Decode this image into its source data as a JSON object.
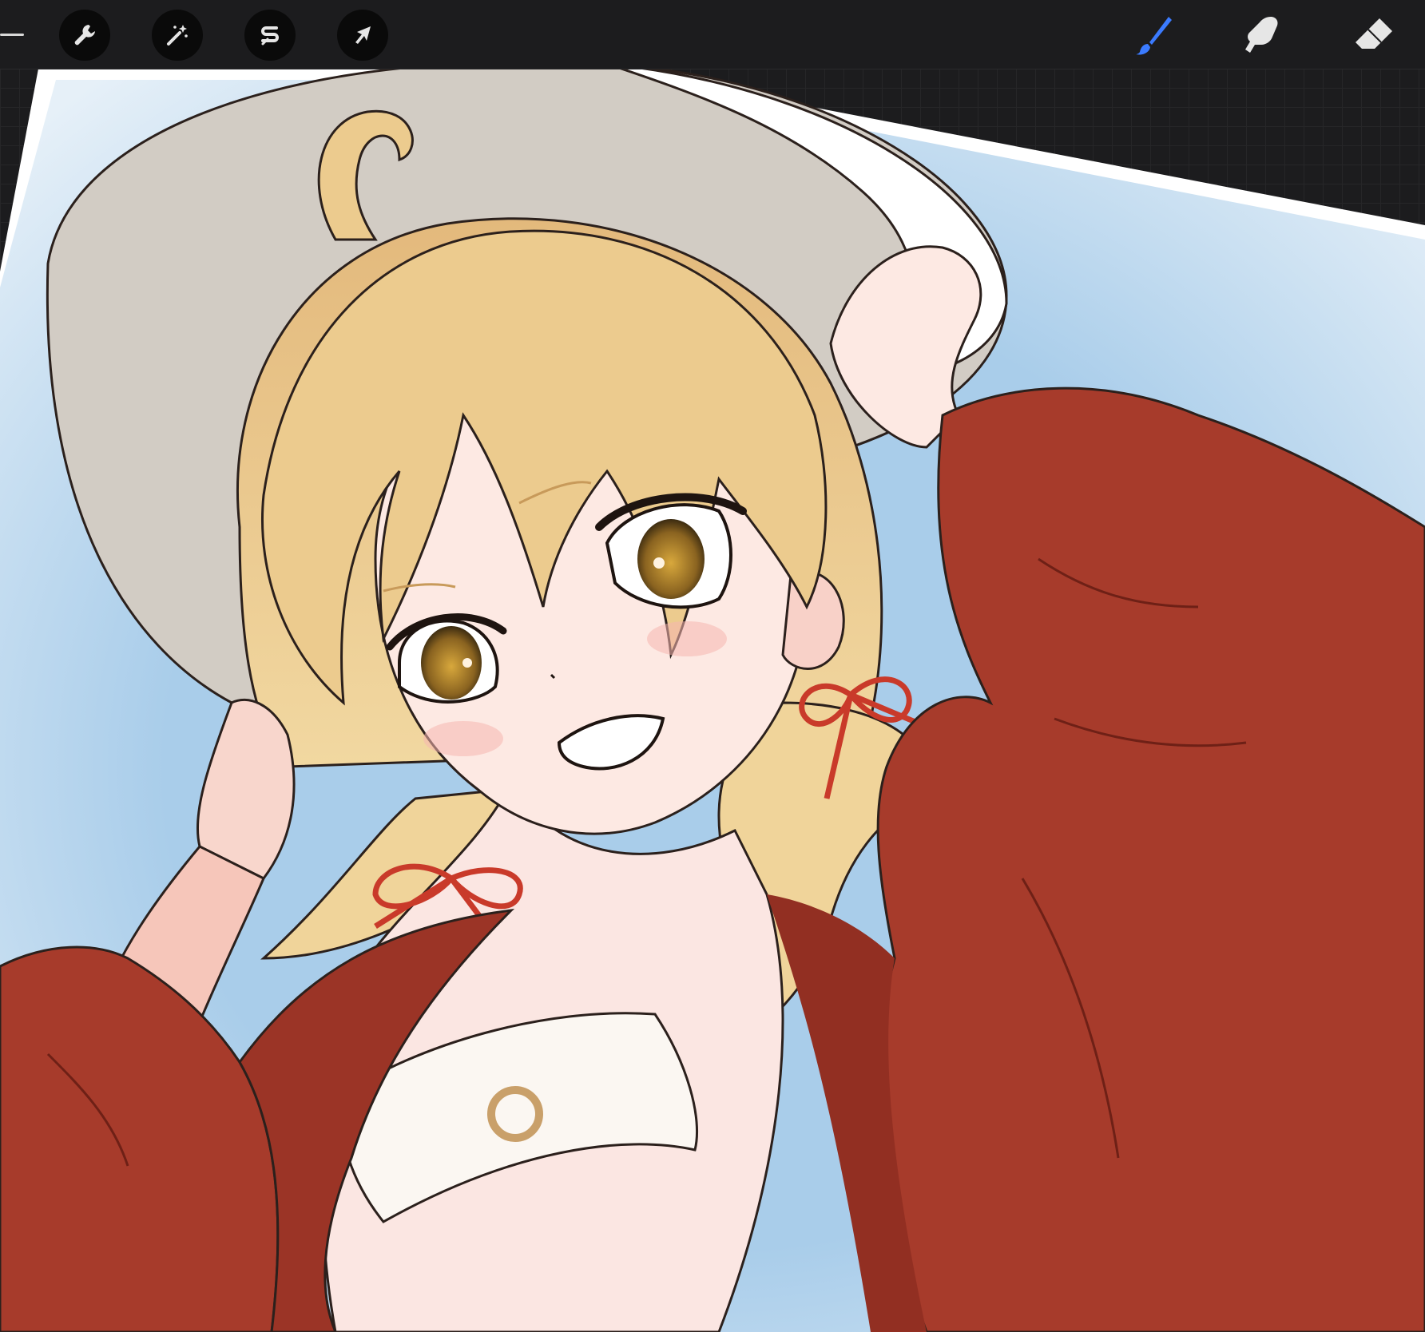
{
  "app": {
    "left_tools": [
      {
        "name": "actions",
        "icon": "wrench-icon"
      },
      {
        "name": "adjustments",
        "icon": "magic-wand-icon"
      },
      {
        "name": "selection",
        "icon": "selection-s-icon"
      },
      {
        "name": "transform",
        "icon": "arrow-cursor-icon"
      }
    ],
    "right_tools": [
      {
        "name": "brush",
        "icon": "paintbrush-icon",
        "active": true
      },
      {
        "name": "smudge",
        "icon": "smudge-finger-icon",
        "active": false
      },
      {
        "name": "eraser",
        "icon": "eraser-icon",
        "active": false
      }
    ],
    "colors": {
      "toolbar_bg": "#1c1c1e",
      "active_tool": "#3b7bff",
      "inactive_tool": "#e6e6e6",
      "canvas_white": "#ffffff",
      "sky_blue": "#a9cdea",
      "jacket_red": "#a73b2b",
      "hair_blonde": "#e8c68a",
      "hat_grey": "#d2ccc4"
    }
  }
}
